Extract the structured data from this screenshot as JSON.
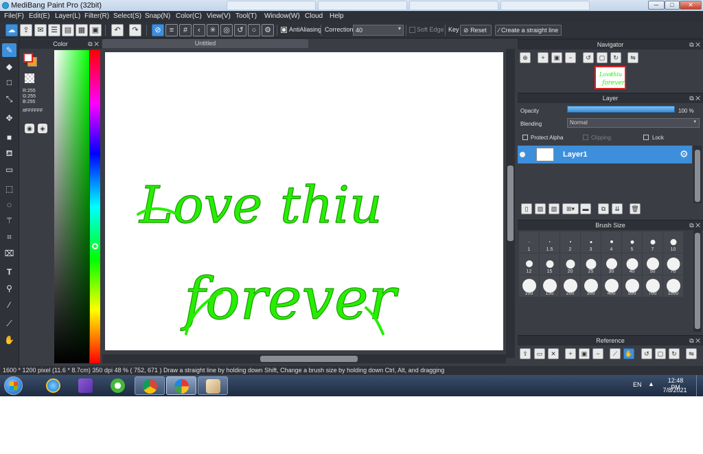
{
  "window": {
    "title": "MediBang Paint Pro (32bit)",
    "minimize": "─",
    "maximize": "□",
    "close": "✕"
  },
  "menu": [
    "File(F)",
    "Edit(E)",
    "Layer(L)",
    "Filter(R)",
    "Select(S)",
    "Snap(N)",
    "Color(C)",
    "View(V)",
    "Tool(T)",
    "Window(W)",
    "Cloud",
    "Help"
  ],
  "toolbar": {
    "antialiasing_label": "AntiAliasing",
    "antialiasing_checked": true,
    "correction_label": "Correction",
    "correction_value": "40",
    "soft_edge_label": "Soft Edge",
    "key_label": "Key",
    "reset_label": "Reset",
    "straight_line_label": "Create a straight line"
  },
  "color_panel": {
    "title": "Color",
    "r": "R:255",
    "g": "G:255",
    "b": "B:255",
    "hex": "#FFFFFF",
    "foreground": "#ffffff",
    "background": "#f0a020",
    "hue_level": 0.63
  },
  "canvas": {
    "tab_title": "Untitled",
    "artwork_text": [
      "Love",
      "thiu",
      "forever"
    ],
    "ink_color": "#22ee00"
  },
  "navigator": {
    "title": "Navigator"
  },
  "layer_panel": {
    "title": "Layer",
    "opacity_label": "Opacity",
    "opacity_value": "100 %",
    "opacity_level": 1.0,
    "blending_label": "Blending",
    "blending_value": "Normal",
    "protect_alpha": "Protect Alpha",
    "clipping": "Clipping",
    "lock": "Lock",
    "layers": [
      {
        "name": "Layer1",
        "selected": true
      }
    ]
  },
  "brush_size": {
    "title": "Brush Size",
    "sizes": [
      "1",
      "1.5",
      "2",
      "3",
      "4",
      "5",
      "7",
      "10",
      "12",
      "15",
      "20",
      "25",
      "30",
      "40",
      "50",
      "70",
      "100",
      "150",
      "200",
      "300",
      "400",
      "500",
      "700",
      "1000"
    ]
  },
  "reference": {
    "title": "Reference"
  },
  "status": {
    "text": "1600 * 1200 pixel   (11.6 * 8.7cm)   350 dpi   48 %   ( 752, 671 )   Draw a straight line by holding down Shift, Change a brush size by holding down Ctrl, Alt, and dragging"
  },
  "taskbar": {
    "apps": [
      "start-orb",
      "internet-explorer-icon",
      "visual-studio-icon",
      "green-app-icon",
      "chrome-icon",
      "medibang-icon",
      "paint-icon"
    ],
    "language": "EN",
    "time": "12:48 PM",
    "date": "7/8/2021"
  }
}
